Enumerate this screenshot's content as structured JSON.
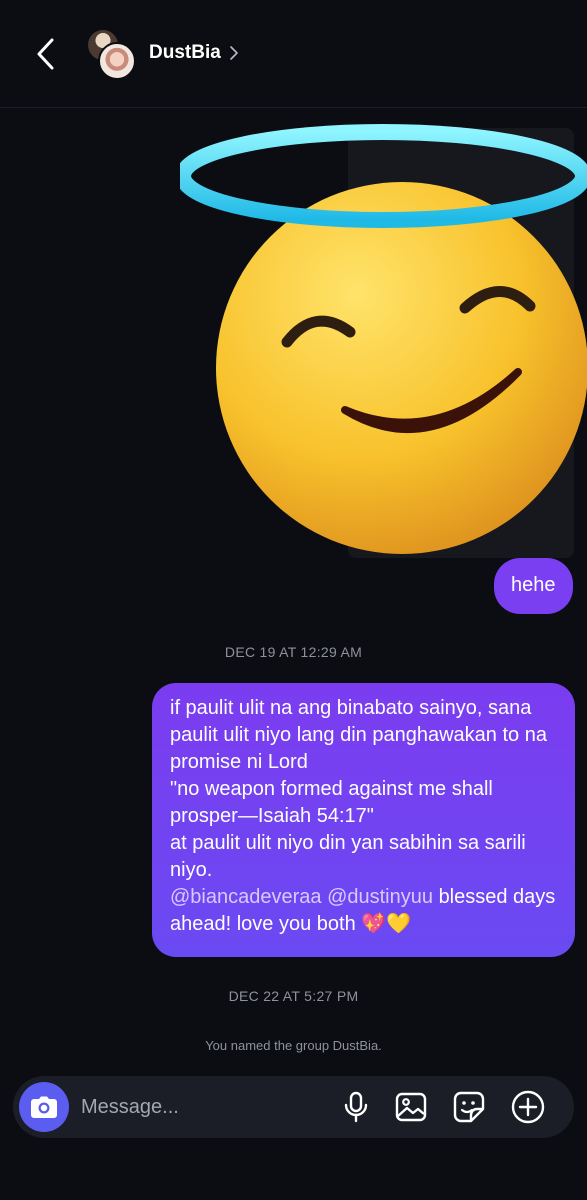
{
  "header": {
    "group_name": "DustBia"
  },
  "messages": {
    "hehe": "hehe",
    "timestamp_1": "DEC 19 AT 12:29 AM",
    "long_message": {
      "line_1": "if paulit ulit na ang binabato sainyo, sana paulit ulit niyo lang din panghawakan to na promise ni Lord",
      "line_2": "\"no weapon formed against me shall prosper—Isaiah 54:17\"",
      "line_3": "at paulit ulit niyo din yan sabihin sa sarili niyo.",
      "mention_1": "@biancadeveraa",
      "mention_2": "@dustinyuu",
      "closing": "blessed days ahead! love you both 💖💛"
    },
    "timestamp_2": "DEC 22 AT 5:27 PM",
    "system_note": "You named the group DustBia."
  },
  "composer": {
    "placeholder": "Message..."
  },
  "icons": {
    "back": "chevron-left-icon",
    "camera": "camera-icon",
    "mic": "microphone-icon",
    "gallery": "image-icon",
    "sticker": "sticker-icon",
    "plus": "plus-circle-icon"
  },
  "colors": {
    "background": "#0b0d12",
    "bubble": "#7a3ff0",
    "camera_button": "#5b5cf0",
    "timestamp": "#8e929b"
  }
}
